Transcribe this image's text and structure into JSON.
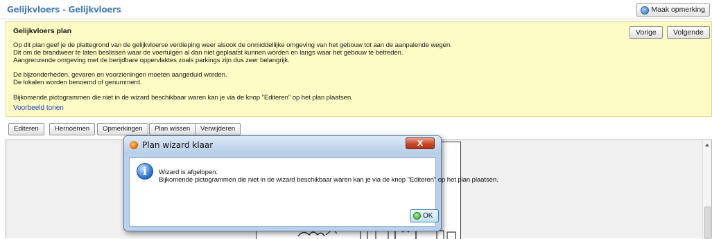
{
  "header": {
    "title": "Gelijkvloers - Gelijkvloers",
    "remark_button": "Maak opmerking"
  },
  "panel": {
    "title": "Gelijkvloers plan",
    "lines": [
      "Op dit plan geef je de plattegrond van de gelijkvloerse verdieping weer alsook de onmiddellijke omgeving van het gebouw tot aan de aanpalende wegen.",
      "Dit om de brandweer te laten beslissen waar de voertuigen al dan niet geplaatst kunnen worden en langs waar het gebouw te betreden.",
      "Aangrenzende omgeving met de berijdbare oppervlaktes zoals parkings zijn dus zeer belangrijk.",
      "De bijzonderheden, gevaren en voorzieningen moeten aangeduid worden.",
      "De lokalen worden benoemd of genummerd.",
      "Bijkomende pictogrammen die niet in de wizard beschikbaar waren kan je via de knop \"Editeren\" op het plan plaatsen."
    ],
    "example_link": "Voorbeeld tonen",
    "prev_button": "Vorige",
    "next_button": "Volgende"
  },
  "actions": {
    "edit": "Editeren",
    "rename": "Hernoemen",
    "remarks": "Opmerkingen",
    "clear_plan": "Plan wissen",
    "delete": "Verwijderen"
  },
  "dialog": {
    "title": "Plan wizard klaar",
    "close_glyph": "X",
    "info_glyph": "i",
    "message_line1": "Wizard is afgelopen.",
    "message_line2": "Bijkomende pictogrammen die niet in de wizard beschikbaar waren kan je via de knop \"Editeren\" op het plan plaatsen.",
    "ok_button": "OK"
  },
  "colors": {
    "title_blue": "#4a7fb5",
    "panel_yellow": "#fcfcc4",
    "link_blue": "#1a3fc8",
    "dialog_frame": "#b9d1ea"
  }
}
